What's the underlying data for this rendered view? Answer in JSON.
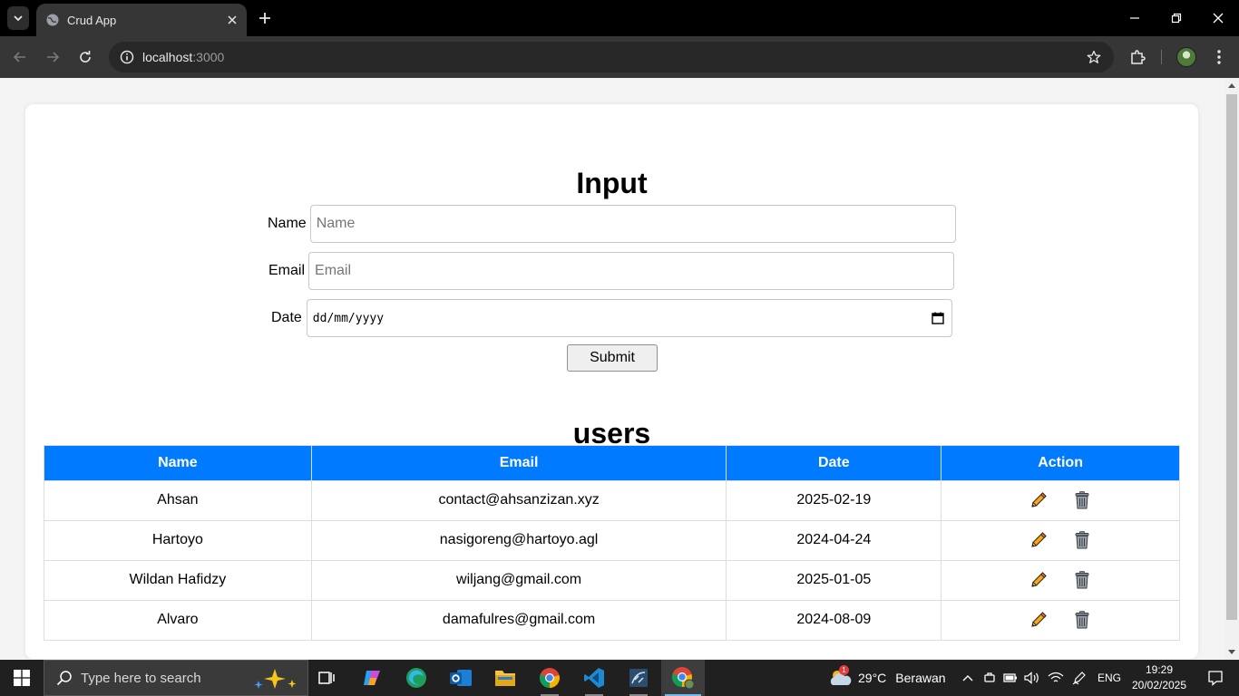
{
  "browser": {
    "tab_title": "Crud App",
    "url_host": "localhost",
    "url_port": ":3000"
  },
  "page": {
    "form_heading": "Input",
    "name_label": "Name",
    "name_placeholder": "Name",
    "email_label": "Email",
    "email_placeholder": "Email",
    "date_label": "Date",
    "date_placeholder": "dd/mm/yyyy",
    "submit_label": "Submit",
    "table_heading": "users",
    "columns": [
      "Name",
      "Email",
      "Date",
      "Action"
    ],
    "rows": [
      {
        "name": "Ahsan",
        "email": "contact@ahsanzizan.xyz",
        "date": "2025-02-19"
      },
      {
        "name": "Hartoyo",
        "email": "nasigoreng@hartoyo.agl",
        "date": "2024-04-24"
      },
      {
        "name": "Wildan Hafidzy",
        "email": "wiljang@gmail.com",
        "date": "2025-01-05"
      },
      {
        "name": "Alvaro",
        "email": "damafulres@gmail.com",
        "date": "2024-08-09"
      }
    ],
    "edit_icon": "pencil-icon",
    "delete_icon": "trash-icon"
  },
  "taskbar": {
    "search_placeholder": "Type here to search",
    "weather_temp": "29°C",
    "weather_desc": "Berawan",
    "weather_badge": "1",
    "language": "ENG",
    "time": "19:29",
    "date": "20/02/2025"
  },
  "colors": {
    "table_header": "#007bff",
    "page_bg": "#f4f4f4",
    "taskbar_bg": "#202020"
  }
}
